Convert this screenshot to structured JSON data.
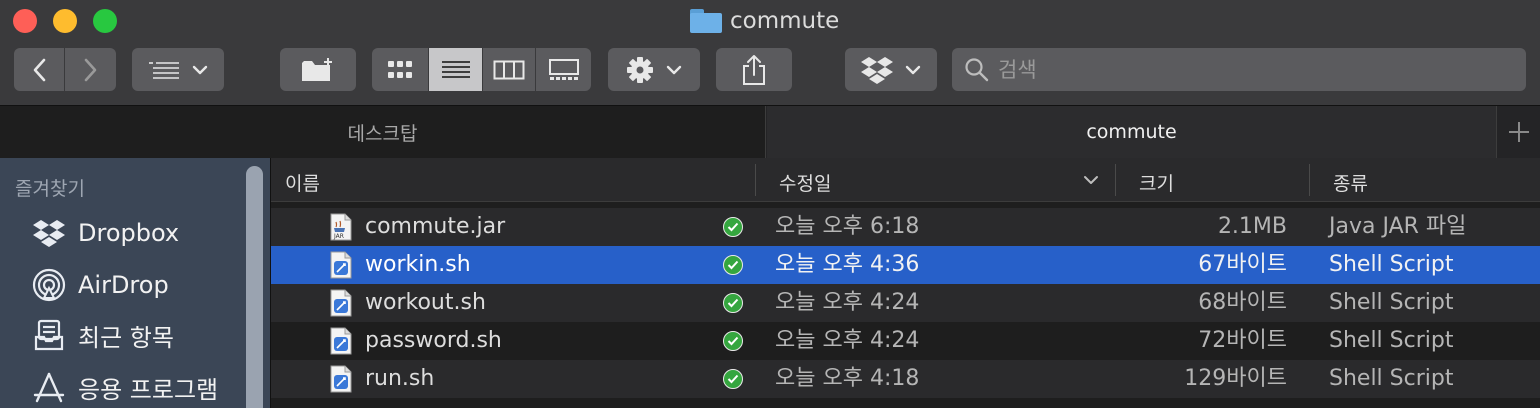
{
  "window": {
    "title": "commute",
    "folder_icon": "folder-icon",
    "accent": "#2760c9"
  },
  "toolbar": {
    "search_placeholder": "검색",
    "buttons": [
      "back",
      "forward",
      "group-by",
      "new-folder",
      "view-icons",
      "view-list",
      "view-columns",
      "view-gallery",
      "action-gear",
      "share",
      "dropbox"
    ]
  },
  "tabs": [
    {
      "label": "데스크탑",
      "active": false
    },
    {
      "label": "commute",
      "active": true
    }
  ],
  "sidebar": {
    "header": "즐겨찾기",
    "items": [
      {
        "label": "Dropbox",
        "icon": "dropbox-icon"
      },
      {
        "label": "AirDrop",
        "icon": "airdrop-icon"
      },
      {
        "label": "최근 항목",
        "icon": "recents-icon"
      },
      {
        "label": "응용 프로그램",
        "icon": "applications-icon"
      }
    ]
  },
  "columns": {
    "name": "이름",
    "date": "수정일",
    "size": "크기",
    "kind": "종류"
  },
  "files": [
    {
      "name": "commute.jar",
      "date": "오늘 오후 6:18",
      "size": "2.1MB",
      "kind": "Java JAR 파일",
      "icon": "jar-icon",
      "selected": false
    },
    {
      "name": "workin.sh",
      "date": "오늘 오후 4:36",
      "size": "67바이트",
      "kind": "Shell Script",
      "icon": "script-icon",
      "selected": true
    },
    {
      "name": "workout.sh",
      "date": "오늘 오후 4:24",
      "size": "68바이트",
      "kind": "Shell Script",
      "icon": "script-icon",
      "selected": false
    },
    {
      "name": "password.sh",
      "date": "오늘 오후 4:24",
      "size": "72바이트",
      "kind": "Shell Script",
      "icon": "script-icon",
      "selected": false
    },
    {
      "name": "run.sh",
      "date": "오늘 오후 4:18",
      "size": "129바이트",
      "kind": "Shell Script",
      "icon": "script-icon",
      "selected": false
    }
  ]
}
